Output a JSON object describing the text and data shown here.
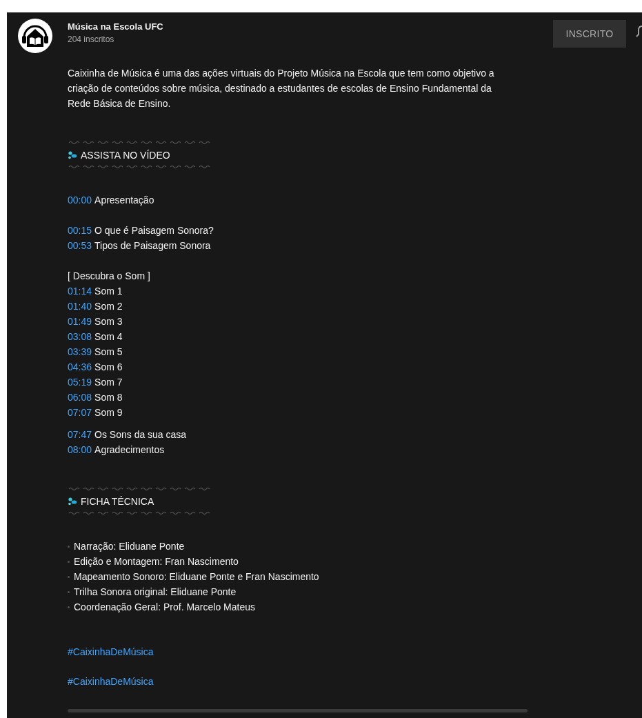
{
  "channel": {
    "name": "Música na Escola UFC",
    "subscribers": "204 inscritos"
  },
  "subscribe_button": {
    "label": "INSCRITO"
  },
  "description": "Caixinha de Música é uma das ações virtuais do Projeto Música na Escola que tem como objetivo a criação de conteúdos sobre música, destinado a estudantes de escolas de Ensino Fundamental da Rede Básica de Ensino.",
  "blocks": [
    {
      "kind": "heading",
      "text": "ASSISTA NO VÍDEO"
    },
    {
      "kind": "lines",
      "lines": [
        {
          "kind": "chapter",
          "time": "00:00",
          "title": "Apresentação"
        }
      ]
    },
    {
      "kind": "lines",
      "lines": [
        {
          "kind": "chapter",
          "time": "00:15",
          "title": "O que é Paisagem Sonora?"
        },
        {
          "kind": "chapter",
          "time": "00:53",
          "title": "Tipos de Paisagem Sonora"
        }
      ]
    },
    {
      "kind": "lines",
      "lines": [
        {
          "kind": "text",
          "text": "[ Descubra o Som ]"
        },
        {
          "kind": "chapter",
          "time": "01:14",
          "title": "Som 1"
        },
        {
          "kind": "chapter",
          "time": "01:40",
          "title": "Som 2"
        },
        {
          "kind": "chapter",
          "time": "01:49",
          "title": "Som 3"
        },
        {
          "kind": "chapter",
          "time": "03:08",
          "title": "Som 4"
        },
        {
          "kind": "chapter",
          "time": "03:39",
          "title": "Som 5"
        },
        {
          "kind": "chapter",
          "time": "04:36",
          "title": "Som 6"
        },
        {
          "kind": "chapter",
          "time": "05:19",
          "title": "Som 7"
        },
        {
          "kind": "chapter",
          "time": "06:08",
          "title": "Som 8"
        },
        {
          "kind": "chapter",
          "time": "07:07",
          "title": "Som 9"
        }
      ]
    },
    {
      "kind": "lines",
      "tight": true,
      "lines": [
        {
          "kind": "chapter",
          "time": "07:47",
          "title": "Os Sons da sua casa"
        },
        {
          "kind": "chapter",
          "time": "08:00",
          "title": "Agradecimentos"
        }
      ]
    },
    {
      "kind": "heading",
      "text": "FICHA TÉCNICA"
    },
    {
      "kind": "lines",
      "lines": [
        {
          "kind": "credit",
          "text": "Narração: Eliduane Ponte"
        },
        {
          "kind": "credit",
          "text": "Edição e Montagem: Fran Nascimento"
        },
        {
          "kind": "credit",
          "text": "Mapeamento Sonoro: Eliduane Ponte e Fran Nascimento"
        },
        {
          "kind": "credit",
          "text": "Trilha Sonora original: Eliduane Ponte"
        },
        {
          "kind": "credit",
          "text": "Coordenação Geral: Prof. Marcelo Mateus"
        }
      ]
    },
    {
      "kind": "lines",
      "lines": [
        {
          "kind": "hashtag",
          "text": "#CaixinhaDeMúsica"
        }
      ]
    },
    {
      "kind": "lines",
      "lines": [
        {
          "kind": "hashtag",
          "text": "#CaixinhaDeMúsica"
        }
      ]
    }
  ]
}
